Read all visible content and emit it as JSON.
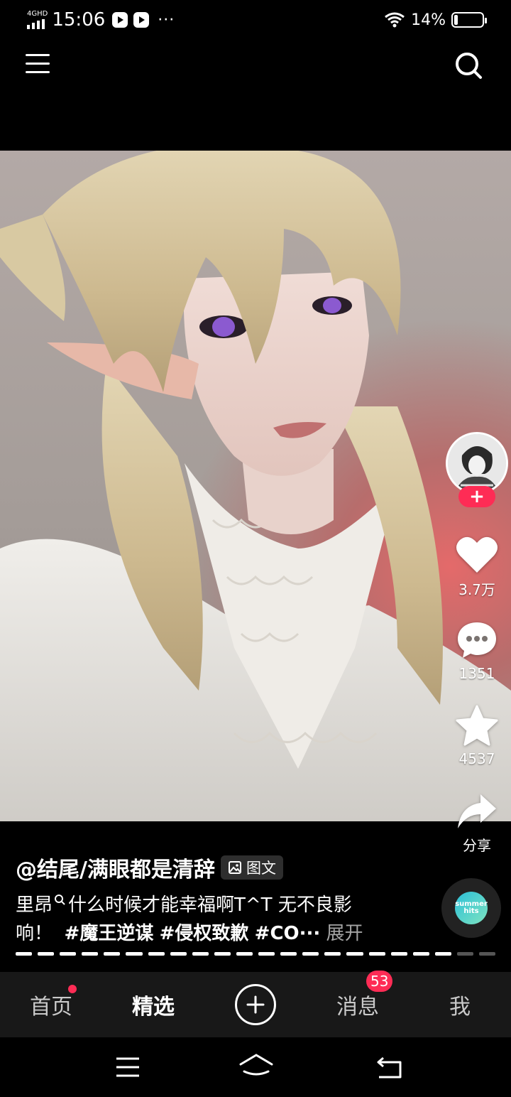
{
  "status_bar": {
    "network": "4GHD",
    "time": "15:06",
    "more": "···",
    "battery": "14%",
    "battery_level": 0.14
  },
  "top_bar": {
    "menu_icon": "menu-icon",
    "search_icon": "search-icon"
  },
  "actions": {
    "likes": "3.7万",
    "comments": "1351",
    "favorites": "4537",
    "share": "分享",
    "follow": "+"
  },
  "post": {
    "author": "@结尾/满眼都是清辞",
    "type_tag": "图文",
    "text_line1": "里昂",
    "text_search_hint": "什么时候才能幸福啊T^T 无不良影",
    "text_line2": "响！",
    "hashtags": [
      "#魔王逆谋",
      "#侵权致歉",
      "#CO···"
    ],
    "expand": "展开"
  },
  "progress": {
    "total": 22,
    "current": 20
  },
  "music": {
    "label": "summer hits"
  },
  "bottom_nav": {
    "home": "首页",
    "featured": "精选",
    "messages": "消息",
    "messages_badge": "53",
    "me": "我"
  },
  "colors": {
    "accent": "#fe2c55",
    "nav_bg": "#181818"
  }
}
